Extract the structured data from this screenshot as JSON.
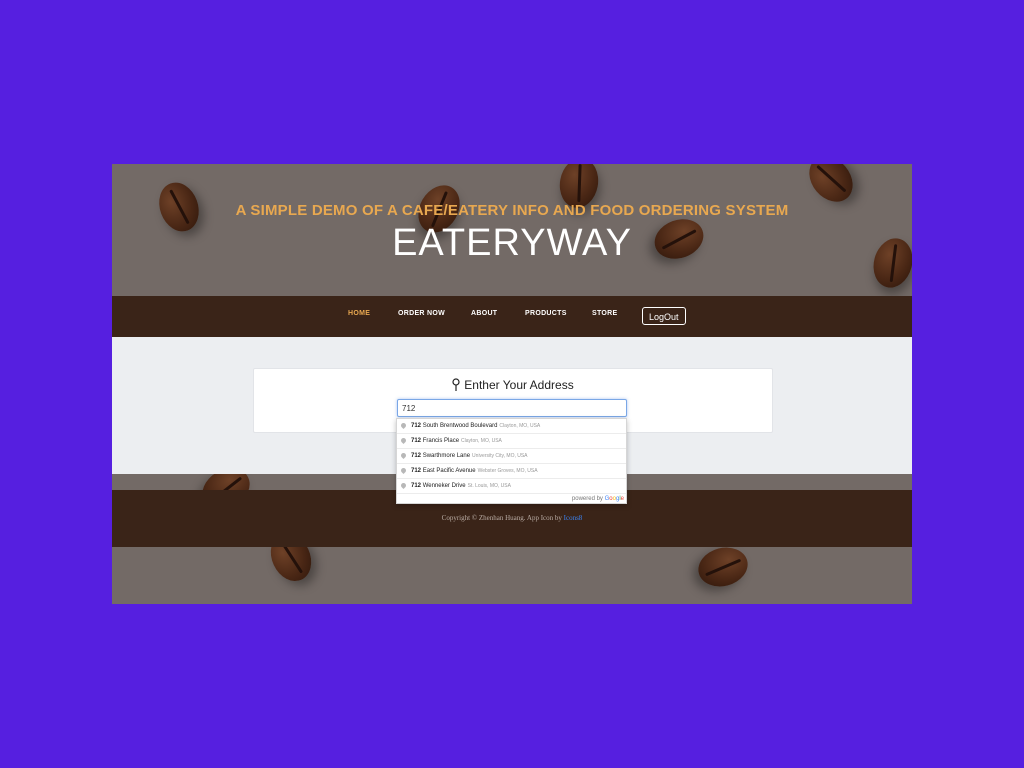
{
  "hero": {
    "subtitle": "A SIMPLE DEMO OF A CAFE/EATERY INFO AND FOOD ORDERING SYSTEM",
    "title": "EATERYWAY"
  },
  "nav": {
    "items": [
      {
        "label": "HOME",
        "active": true
      },
      {
        "label": "ORDER NOW",
        "active": false
      },
      {
        "label": "ABOUT",
        "active": false
      },
      {
        "label": "PRODUCTS",
        "active": false
      },
      {
        "label": "STORE",
        "active": false
      }
    ],
    "logout_label": "LogOut"
  },
  "address_card": {
    "heading": "Enther Your Address",
    "input_value": "712",
    "icon": "map-pin-icon"
  },
  "autocomplete": {
    "suggestions": [
      {
        "number": "712",
        "street": "South Brentwood Boulevard",
        "secondary": "Clayton, MO, USA"
      },
      {
        "number": "712",
        "street": "Francis Place",
        "secondary": "Clayton, MO, USA"
      },
      {
        "number": "712",
        "street": "Swarthmore Lane",
        "secondary": "University City, MO, USA"
      },
      {
        "number": "712",
        "street": "East Pacific Avenue",
        "secondary": "Webster Groves, MO, USA"
      },
      {
        "number": "712",
        "street": "Wenneker Drive",
        "secondary": "St. Louis, MO, USA"
      }
    ],
    "powered_by": "powered by",
    "google": {
      "g1": "G",
      "g2": "o",
      "g3": "o",
      "g4": "g",
      "g5": "l",
      "g6": "e"
    }
  },
  "footer": {
    "copyright": "Copyright © Zhenhan Huang. App Icon by ",
    "link": "Icons8"
  },
  "colors": {
    "page_bg": "#561fe0",
    "accent": "#e8a850",
    "nav_bg": "#3a2418",
    "content_bg": "#eceef1"
  }
}
